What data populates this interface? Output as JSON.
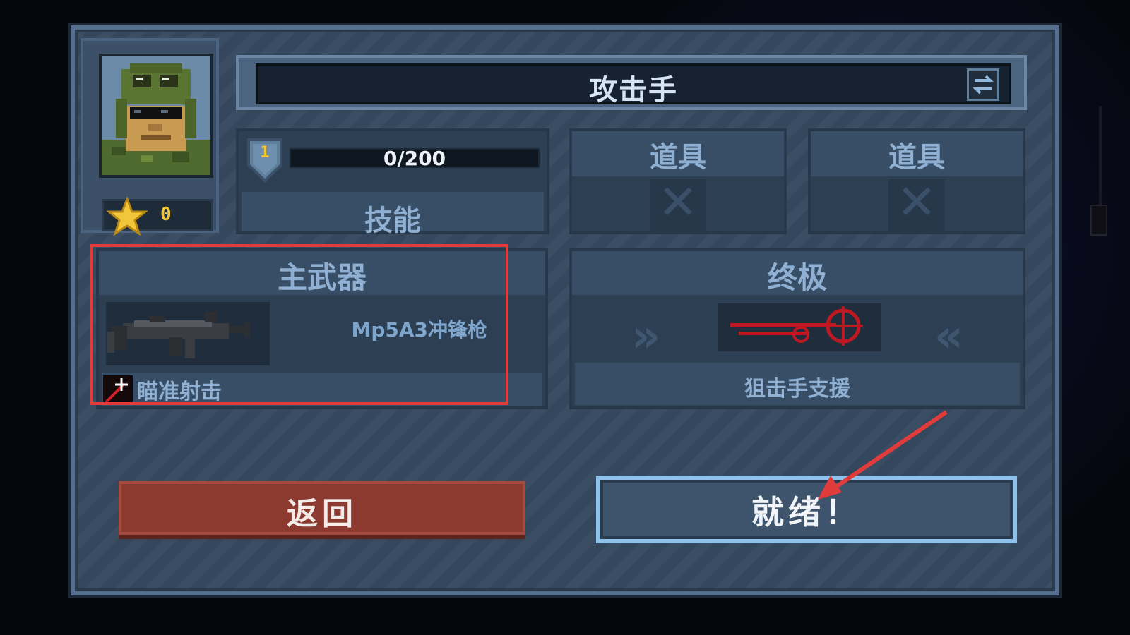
{
  "character": {
    "class_name": "攻击手",
    "stars": "0",
    "level": "1",
    "xp_text": "0/200",
    "xp_progress": 0
  },
  "slots": {
    "skill_label": "技能",
    "item1_label": "道具",
    "item2_label": "道具",
    "primary_label": "主武器",
    "ultimate_label": "终极"
  },
  "primary_weapon": {
    "name": "Mp5A3冲锋枪",
    "ability": "瞄准射击"
  },
  "ultimate": {
    "name": "狙击手支援"
  },
  "buttons": {
    "back": "返回",
    "ready": "就绪！"
  },
  "annotations": {
    "highlight_color": "#e23b3b",
    "arrow_color": "#e23b3b"
  },
  "colors": {
    "panel": "#34475c",
    "back_button": "#8c3a30",
    "ready_border": "#8ec2ea",
    "star": "#f2c63b"
  },
  "icons": {
    "portrait": "soldier-portrait-icon",
    "star": "star-icon",
    "swap": "swap-arrows-icon",
    "level": "shield-level-icon",
    "empty_item": "x-mark-icon",
    "weapon": "smg-icon",
    "aim": "aim-shot-icon",
    "ultimate": "sniper-crosshair-icon"
  }
}
